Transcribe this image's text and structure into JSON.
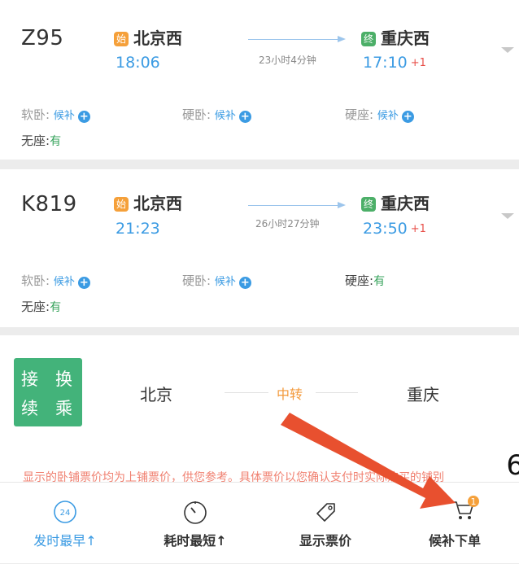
{
  "trains": [
    {
      "number": "Z95",
      "from": {
        "badge": "始",
        "station": "北京西",
        "time": "18:06"
      },
      "duration": "23小时4分钟",
      "to": {
        "badge": "终",
        "station": "重庆西",
        "time": "17:10",
        "day_offset": "+1"
      },
      "seats": [
        {
          "label": "软卧:",
          "value": "候补",
          "plus": "+"
        },
        {
          "label": "硬卧:",
          "value": "候补",
          "plus": "+"
        },
        {
          "label": "硬座:",
          "value": "候补",
          "plus": "+"
        },
        {
          "label": "无座:",
          "value": "有"
        }
      ]
    },
    {
      "number": "K819",
      "from": {
        "badge": "始",
        "station": "北京西",
        "time": "21:23"
      },
      "duration": "26小时27分钟",
      "to": {
        "badge": "终",
        "station": "重庆西",
        "time": "23:50",
        "day_offset": "+1"
      },
      "seats": [
        {
          "label": "软卧:",
          "value": "候补",
          "plus": "+"
        },
        {
          "label": "硬卧:",
          "value": "候补",
          "plus": "+"
        },
        {
          "label": "硬座:",
          "value": "有"
        },
        {
          "label": "无座:",
          "value": "有"
        }
      ]
    }
  ],
  "transfer": {
    "box_chars": [
      "接",
      "换",
      "续",
      "乘"
    ],
    "from_city": "北京",
    "via_label": "中转",
    "to_city": "重庆"
  },
  "notice": {
    "text": "显示的卧铺票价均为上铺票价，供您参考。具体票价以您确认支付时实际购买的铺别",
    "edge_char": "6"
  },
  "bottom_bar": {
    "earliest_icon_text": "24",
    "earliest": "发时最早↑",
    "shortest": "耗时最短↑",
    "show_price": "显示票价",
    "waitlist": "候补下单",
    "waitlist_badge": "1"
  },
  "colors": {
    "accent_blue": "#3b9be3",
    "green": "#37a35c",
    "arrow": "#e8502f",
    "orange": "#f39a3c"
  }
}
